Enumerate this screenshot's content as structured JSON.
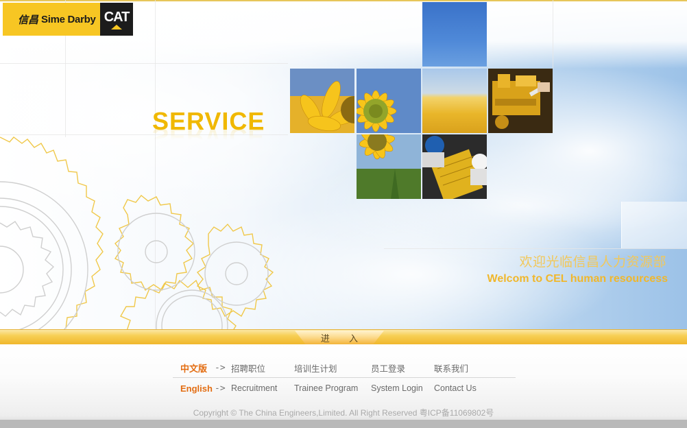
{
  "header": {
    "logo_chinese": "信昌",
    "logo_text": "Sime Darby",
    "cat_label": "CAT"
  },
  "hero": {
    "service_title": "SERVICE",
    "welcome_cn": "欢迎光临信昌人力资源部",
    "welcome_en": "Welcom to CEL human resourcess"
  },
  "enter": {
    "label": "进 入"
  },
  "nav": {
    "chinese": {
      "lang_label": "中文版",
      "arrow": "->",
      "items": [
        "招聘职位",
        "培训生计划",
        "员工登录",
        "联系我们"
      ]
    },
    "english": {
      "lang_label": "English",
      "arrow": "->",
      "items": [
        "Recruitment",
        "Trainee Program",
        "System Login",
        "Contact Us"
      ]
    }
  },
  "footer": {
    "copyright": "Copyright © The China Engineers,Limited. All Right Reserved 粤ICP备11069802号"
  },
  "colors": {
    "brand_yellow": "#f7c623",
    "service_gold": "#f0b800",
    "lang_orange": "#e36d12",
    "link_gray": "#6a6a6a"
  }
}
